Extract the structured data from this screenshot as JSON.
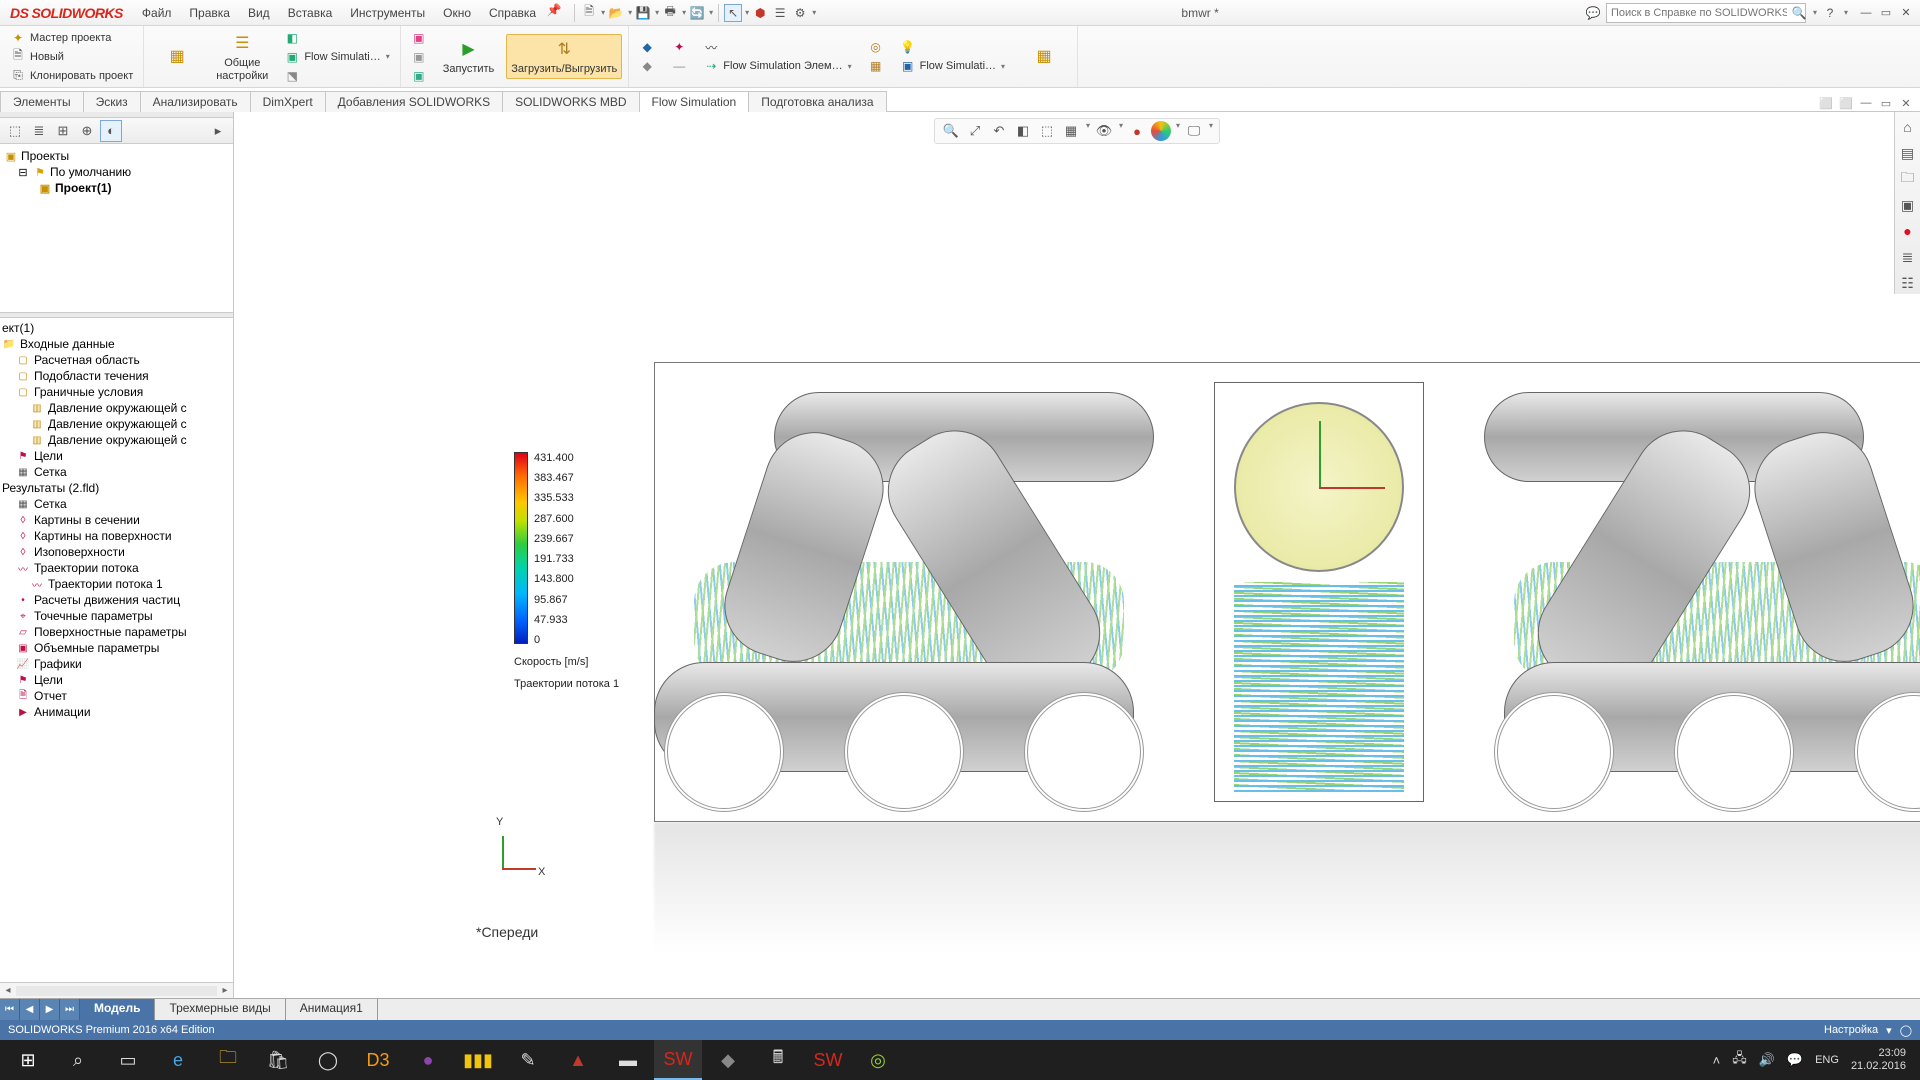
{
  "app": {
    "logo_text": "SOLIDWORKS",
    "doc_title": "bmwr *"
  },
  "menu": {
    "file": "Файл",
    "edit": "Правка",
    "view": "Вид",
    "insert": "Вставка",
    "tools": "Инструменты",
    "window": "Окно",
    "help": "Справка"
  },
  "search": {
    "placeholder": "Поиск в Справке по SOLIDWORKS"
  },
  "ribbon": {
    "left": {
      "wizard": "Мастер проекта",
      "new": "Новый",
      "clone": "Клонировать проект"
    },
    "group1": {
      "general": "Общие\nнастройки",
      "flow_sim": "Flow Simulati…"
    },
    "group2": {
      "run": "Запустить",
      "load": "Загрузить/Выгрузить"
    },
    "group3": {
      "fs_elem": "Flow Simulation Элем…",
      "fs_res": "Flow Simulati…"
    }
  },
  "tabs": {
    "elements": "Элементы",
    "sketch": "Эскиз",
    "analyze": "Анализировать",
    "dimxpert": "DimXpert",
    "addins": "Добавления SOLIDWORKS",
    "mbd": "SOLIDWORKS MBD",
    "flow": "Flow Simulation",
    "prep": "Подготовка анализа"
  },
  "tree_top": {
    "projects": "Проекты",
    "default": "По умолчанию",
    "project1": "Проект(1)"
  },
  "tree_bottom": {
    "proj_header": "ект(1)",
    "input_data": "Входные данные",
    "domain": "Расчетная область",
    "subdomains": "Подобласти течения",
    "boundary": "Граничные условия",
    "bc1": "Давление окружающей с",
    "bc2": "Давление окружающей с",
    "bc3": "Давление окружающей с",
    "goals1": "Цели",
    "mesh": "Сетка",
    "results_header": "Результаты (2.fld)",
    "mesh2": "Сетка",
    "cut_plots": "Картины в сечении",
    "surface_plots": "Картины на поверхности",
    "isosurfaces": "Изоповерхности",
    "flow_traj": "Траектории потока",
    "flow_traj1": "Траектории потока 1",
    "particle": "Расчеты движения частиц",
    "point_params": "Точечные параметры",
    "surface_params": "Поверхностные параметры",
    "volume_params": "Объемные параметры",
    "xy_plots": "Графики",
    "goals2": "Цели",
    "report": "Отчет",
    "anim": "Анимации"
  },
  "legend": {
    "values": [
      "431.400",
      "383.467",
      "335.533",
      "287.600",
      "239.667",
      "191.733",
      "143.800",
      "95.867",
      "47.933",
      "0"
    ],
    "title": "Скорость [m/s]",
    "subtitle": "Траектории потока 1"
  },
  "viewport": {
    "triad_y": "Y",
    "triad_x": "X",
    "orientation": "*Спереди"
  },
  "doc_tabs": {
    "model": "Модель",
    "views3d": "Трехмерные виды",
    "anim1": "Анимация1"
  },
  "statusbar": {
    "edition": "SOLIDWORKS Premium 2016 x64 Edition",
    "customize": "Настройка",
    "mmgs": ""
  },
  "taskbar": {
    "lang": "ENG",
    "time": "23:09",
    "date": "21.02.2016"
  }
}
